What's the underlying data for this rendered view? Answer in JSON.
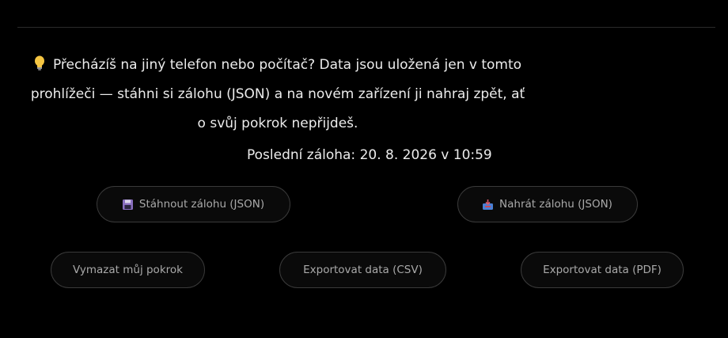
{
  "info": {
    "icon": "lightbulb-icon",
    "text": "Přecházíš na jiný telefon nebo počítač? Data jsou uložená jen v tomto prohlížeči — stáhni si zálohu (JSON) a na novém zařízení ji nahraj zpět, ať o svůj pokrok nepřijdeš."
  },
  "last_backup": "Poslední záloha: 20. 8. 2026 v 10:59",
  "buttons": {
    "download": {
      "label": "Stáhnout zálohu (JSON)",
      "icon": "floppy-disk-icon"
    },
    "upload": {
      "label": "Nahrát zálohu (JSON)",
      "icon": "inbox-tray-icon"
    },
    "clear": {
      "label": "Vymazat můj pokrok"
    },
    "export_csv": {
      "label": "Exportovat data (CSV)"
    },
    "export_pdf": {
      "label": "Exportovat data (PDF)"
    }
  },
  "colors": {
    "background": "#000000",
    "button_border": "#3a3a3a",
    "button_text": "#a9a9a9",
    "text": "#ececec"
  }
}
